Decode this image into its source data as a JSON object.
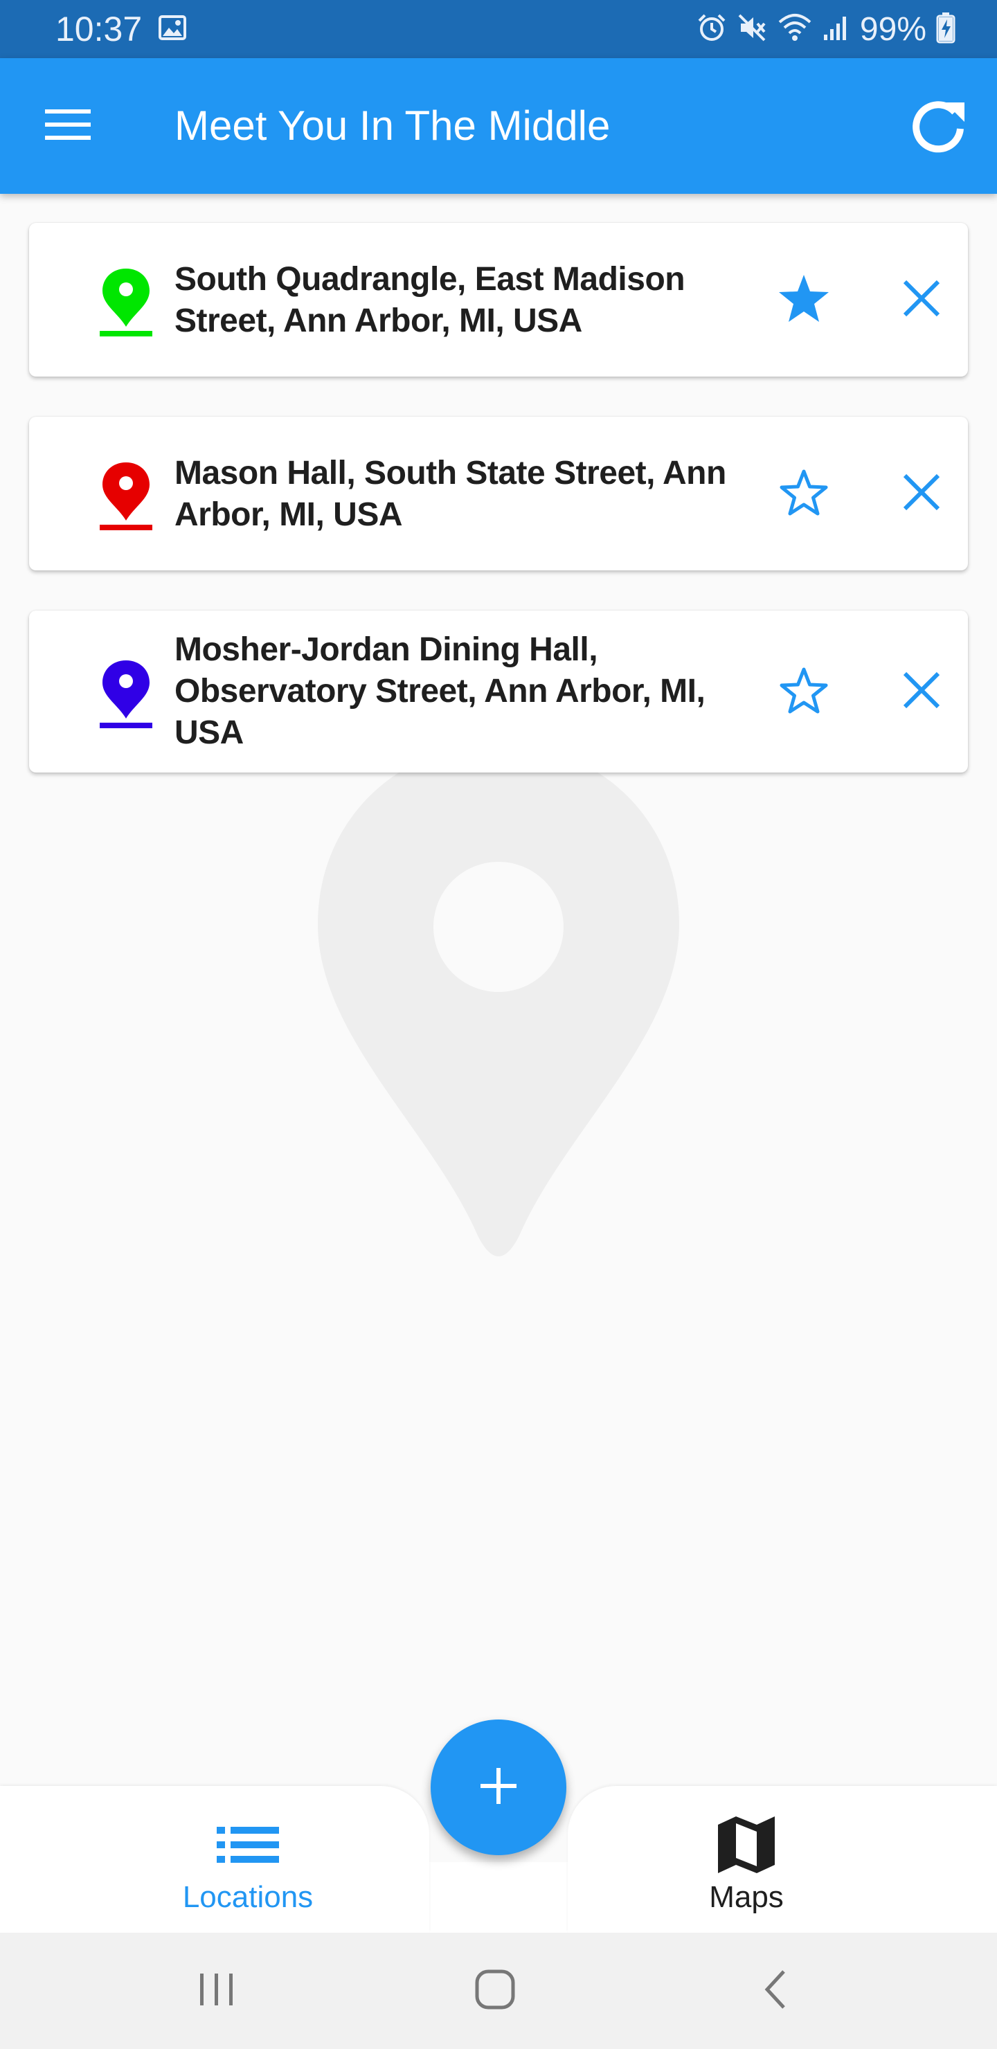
{
  "status_bar": {
    "time": "10:37",
    "battery": "99%",
    "icons": [
      "image-icon",
      "alarm-icon",
      "mute-icon",
      "wifi-icon",
      "signal-icon",
      "battery-charging-icon"
    ]
  },
  "app_bar": {
    "title": "Meet You In The Middle",
    "menu_icon": "menu-icon",
    "refresh_icon": "refresh-icon",
    "color": "#2196f3"
  },
  "locations": [
    {
      "address": "South Quadrangle, East Madison Street, Ann Arbor, MI, USA",
      "pin_color": "#00e600",
      "favorite": true
    },
    {
      "address": "Mason Hall, South State Street, Ann Arbor, MI, USA",
      "pin_color": "#e60000",
      "favorite": false
    },
    {
      "address": "Mosher-Jordan Dining Hall, Observatory Street, Ann Arbor, MI, USA",
      "pin_color": "#3000e6",
      "favorite": false
    }
  ],
  "fab": {
    "icon": "plus-icon"
  },
  "bottom_nav": {
    "items": [
      {
        "label": "Locations",
        "icon": "list-icon",
        "active": true
      },
      {
        "label": "Maps",
        "icon": "map-icon",
        "active": false
      }
    ],
    "active_color": "#2196f3",
    "inactive_color": "#1f1f1f"
  },
  "system_nav": [
    "recents-icon",
    "home-icon",
    "back-icon"
  ]
}
